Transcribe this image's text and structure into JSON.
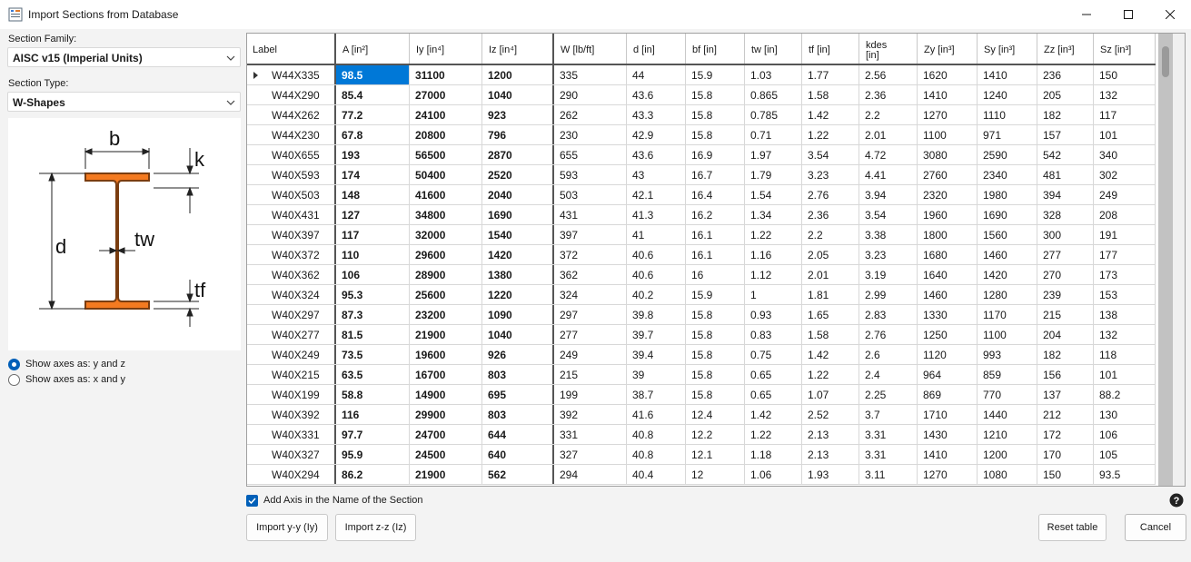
{
  "window": {
    "title": "Import Sections from Database"
  },
  "left": {
    "section_family_label": "Section Family:",
    "section_family_value": "AISC v15 (Imperial Units)",
    "section_type_label": "Section Type:",
    "section_type_value": "W-Shapes",
    "diagram_labels": {
      "b": "b",
      "k": "k",
      "d": "d",
      "tw": "tw",
      "tf": "tf"
    },
    "axes_options": [
      {
        "label": "Show axes as: y and z",
        "selected": true
      },
      {
        "label": "Show axes as: x and y",
        "selected": false
      }
    ]
  },
  "colors": {
    "accent": "#0078d7",
    "beam_fill": "#f47a20",
    "beam_stroke": "#7a3d10"
  },
  "table": {
    "columns": [
      {
        "line1": "Label",
        "line2": ""
      },
      {
        "line1": "A [in²]",
        "line2": ""
      },
      {
        "line1": "Iy [in⁴]",
        "line2": ""
      },
      {
        "line1": "Iz [in⁴]",
        "line2": ""
      },
      {
        "line1": "W [lb/ft]",
        "line2": ""
      },
      {
        "line1": "d [in]",
        "line2": ""
      },
      {
        "line1": "bf [in]",
        "line2": ""
      },
      {
        "line1": "tw [in]",
        "line2": ""
      },
      {
        "line1": "tf [in]",
        "line2": ""
      },
      {
        "line1": "kdes",
        "line2": "[in]"
      },
      {
        "line1": "Zy [in³]",
        "line2": ""
      },
      {
        "line1": "Sy [in³]",
        "line2": ""
      },
      {
        "line1": "Zz [in³]",
        "line2": ""
      },
      {
        "line1": "Sz [in³]",
        "line2": ""
      }
    ],
    "rows": [
      [
        "W44X335",
        "98.5",
        "31100",
        "1200",
        "335",
        "44",
        "15.9",
        "1.03",
        "1.77",
        "2.56",
        "1620",
        "1410",
        "236",
        "150"
      ],
      [
        "W44X290",
        "85.4",
        "27000",
        "1040",
        "290",
        "43.6",
        "15.8",
        "0.865",
        "1.58",
        "2.36",
        "1410",
        "1240",
        "205",
        "132"
      ],
      [
        "W44X262",
        "77.2",
        "24100",
        "923",
        "262",
        "43.3",
        "15.8",
        "0.785",
        "1.42",
        "2.2",
        "1270",
        "1110",
        "182",
        "117"
      ],
      [
        "W44X230",
        "67.8",
        "20800",
        "796",
        "230",
        "42.9",
        "15.8",
        "0.71",
        "1.22",
        "2.01",
        "1100",
        "971",
        "157",
        "101"
      ],
      [
        "W40X655",
        "193",
        "56500",
        "2870",
        "655",
        "43.6",
        "16.9",
        "1.97",
        "3.54",
        "4.72",
        "3080",
        "2590",
        "542",
        "340"
      ],
      [
        "W40X593",
        "174",
        "50400",
        "2520",
        "593",
        "43",
        "16.7",
        "1.79",
        "3.23",
        "4.41",
        "2760",
        "2340",
        "481",
        "302"
      ],
      [
        "W40X503",
        "148",
        "41600",
        "2040",
        "503",
        "42.1",
        "16.4",
        "1.54",
        "2.76",
        "3.94",
        "2320",
        "1980",
        "394",
        "249"
      ],
      [
        "W40X431",
        "127",
        "34800",
        "1690",
        "431",
        "41.3",
        "16.2",
        "1.34",
        "2.36",
        "3.54",
        "1960",
        "1690",
        "328",
        "208"
      ],
      [
        "W40X397",
        "117",
        "32000",
        "1540",
        "397",
        "41",
        "16.1",
        "1.22",
        "2.2",
        "3.38",
        "1800",
        "1560",
        "300",
        "191"
      ],
      [
        "W40X372",
        "110",
        "29600",
        "1420",
        "372",
        "40.6",
        "16.1",
        "1.16",
        "2.05",
        "3.23",
        "1680",
        "1460",
        "277",
        "177"
      ],
      [
        "W40X362",
        "106",
        "28900",
        "1380",
        "362",
        "40.6",
        "16",
        "1.12",
        "2.01",
        "3.19",
        "1640",
        "1420",
        "270",
        "173"
      ],
      [
        "W40X324",
        "95.3",
        "25600",
        "1220",
        "324",
        "40.2",
        "15.9",
        "1",
        "1.81",
        "2.99",
        "1460",
        "1280",
        "239",
        "153"
      ],
      [
        "W40X297",
        "87.3",
        "23200",
        "1090",
        "297",
        "39.8",
        "15.8",
        "0.93",
        "1.65",
        "2.83",
        "1330",
        "1170",
        "215",
        "138"
      ],
      [
        "W40X277",
        "81.5",
        "21900",
        "1040",
        "277",
        "39.7",
        "15.8",
        "0.83",
        "1.58",
        "2.76",
        "1250",
        "1100",
        "204",
        "132"
      ],
      [
        "W40X249",
        "73.5",
        "19600",
        "926",
        "249",
        "39.4",
        "15.8",
        "0.75",
        "1.42",
        "2.6",
        "1120",
        "993",
        "182",
        "118"
      ],
      [
        "W40X215",
        "63.5",
        "16700",
        "803",
        "215",
        "39",
        "15.8",
        "0.65",
        "1.22",
        "2.4",
        "964",
        "859",
        "156",
        "101"
      ],
      [
        "W40X199",
        "58.8",
        "14900",
        "695",
        "199",
        "38.7",
        "15.8",
        "0.65",
        "1.07",
        "2.25",
        "869",
        "770",
        "137",
        "88.2"
      ],
      [
        "W40X392",
        "116",
        "29900",
        "803",
        "392",
        "41.6",
        "12.4",
        "1.42",
        "2.52",
        "3.7",
        "1710",
        "1440",
        "212",
        "130"
      ],
      [
        "W40X331",
        "97.7",
        "24700",
        "644",
        "331",
        "40.8",
        "12.2",
        "1.22",
        "2.13",
        "3.31",
        "1430",
        "1210",
        "172",
        "106"
      ],
      [
        "W40X327",
        "95.9",
        "24500",
        "640",
        "327",
        "40.8",
        "12.1",
        "1.18",
        "2.13",
        "3.31",
        "1410",
        "1200",
        "170",
        "105"
      ],
      [
        "W40X294",
        "86.2",
        "21900",
        "562",
        "294",
        "40.4",
        "12",
        "1.06",
        "1.93",
        "3.11",
        "1270",
        "1080",
        "150",
        "93.5"
      ]
    ]
  },
  "footer": {
    "add_axis_label": "Add Axis in the Name of the Section",
    "import_yy": "Import y-y (Iy)",
    "import_zz": "Import z-z (Iz)",
    "reset": "Reset table",
    "cancel": "Cancel"
  }
}
